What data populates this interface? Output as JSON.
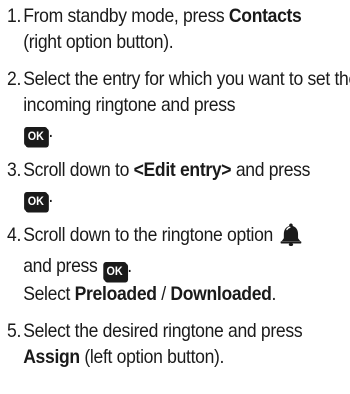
{
  "steps": [
    {
      "number": "1.",
      "text_before": "From standby mode, press ",
      "bold": "Contacts",
      "text_after": " (right option button)."
    },
    {
      "number": "2.",
      "text": "Select the entry for which you want to set the incoming ringtone and press",
      "key": "OK",
      "end": "."
    },
    {
      "number": "3.",
      "text_before": "Scroll down to ",
      "bold": "<Edit entry>",
      "text_after": " and press",
      "key": "OK",
      "end": "."
    },
    {
      "number": "4.",
      "text_before": "Scroll down to the ringtone option",
      "icon": "bell-icon",
      "text_mid": "and press ",
      "key": "OK",
      "end": ".",
      "select_label": "Select ",
      "option1": "Preloaded",
      "separator": " / ",
      "option2": "Downloaded",
      "select_end": "."
    },
    {
      "number": "5.",
      "text_before": "Select the desired ringtone and press ",
      "bold": "Assign",
      "text_after": " (left option button)."
    }
  ]
}
